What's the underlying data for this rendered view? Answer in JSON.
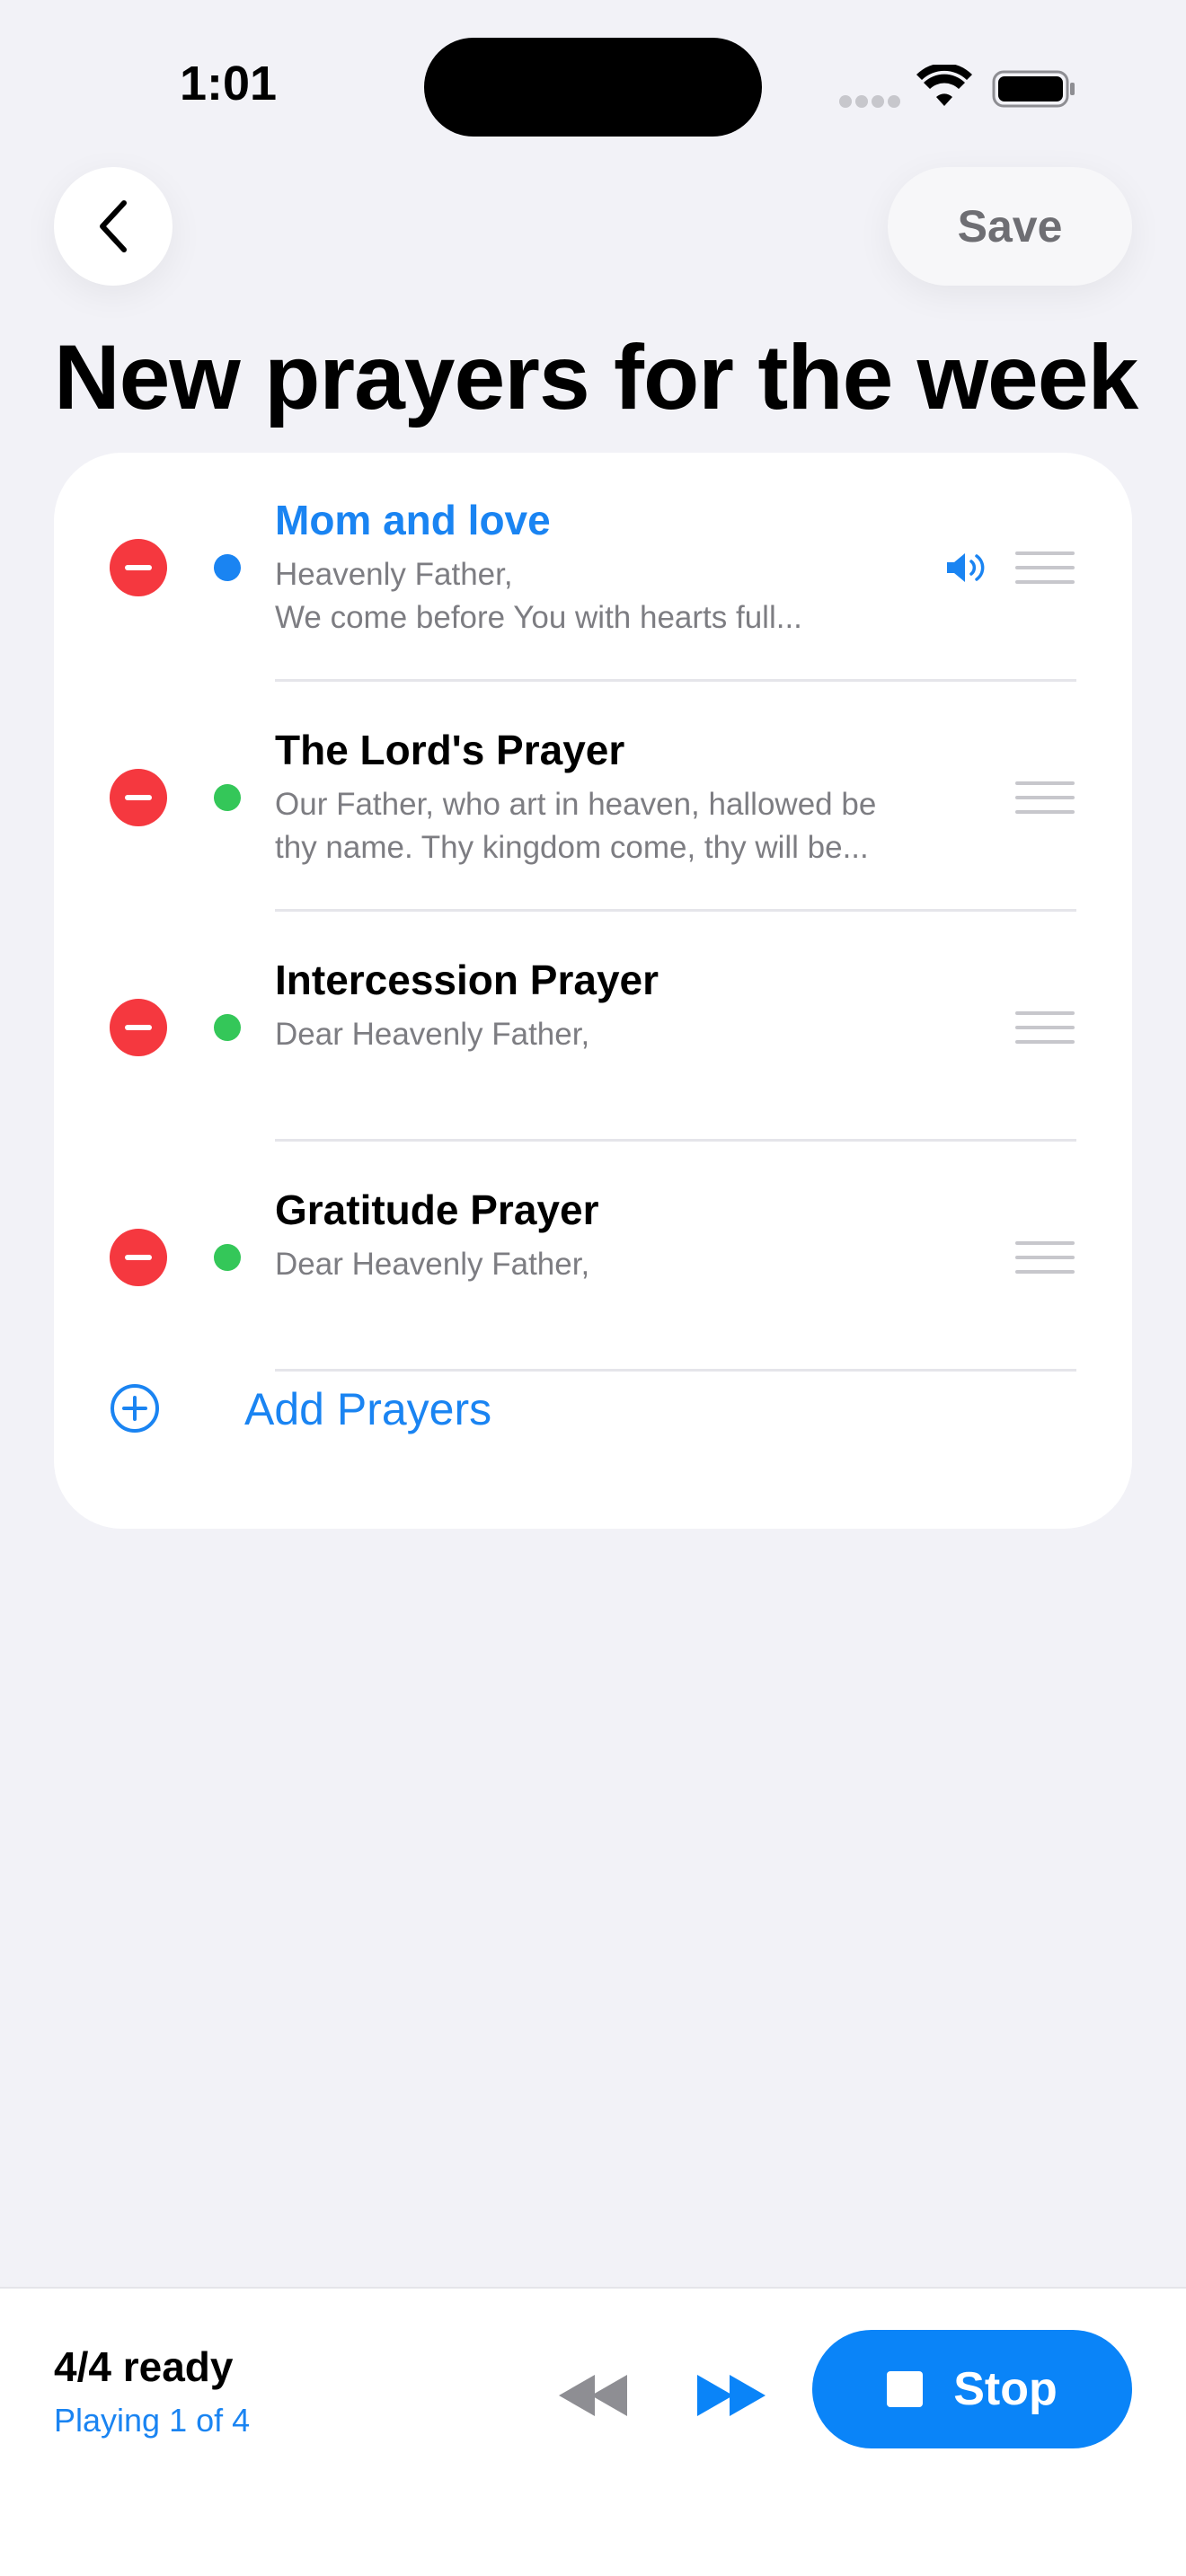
{
  "status_bar": {
    "time": "1:01"
  },
  "header": {
    "save_label": "Save",
    "title": "New prayers for the week"
  },
  "prayers": [
    {
      "title": "Mom and love",
      "line1": "Heavenly Father,",
      "line2": "We come before You with hearts full...",
      "dot_color": "#1a84f2",
      "title_color": "#1a84f2",
      "playing": true
    },
    {
      "title": "The Lord's Prayer",
      "line1": "Our Father, who art in heaven, hallowed be",
      "line2": "thy name. Thy kingdom come, thy will be...",
      "dot_color": "#34c759",
      "title_color": "#000000",
      "playing": false
    },
    {
      "title": "Intercession Prayer",
      "line1": "Dear Heavenly Father,",
      "line2": "",
      "dot_color": "#34c759",
      "title_color": "#000000",
      "playing": false
    },
    {
      "title": "Gratitude Prayer",
      "line1": "Dear Heavenly Father,",
      "line2": "",
      "dot_color": "#34c759",
      "title_color": "#000000",
      "playing": false
    }
  ],
  "add_prayers_label": "Add Prayers",
  "player": {
    "ready_text": "4/4 ready",
    "playing_text": "Playing 1 of 4",
    "stop_label": "Stop"
  },
  "colors": {
    "accent": "#0a84f8",
    "remove": "#f5383f",
    "ready_dot": "#34c759",
    "background": "#f2f2f7"
  }
}
